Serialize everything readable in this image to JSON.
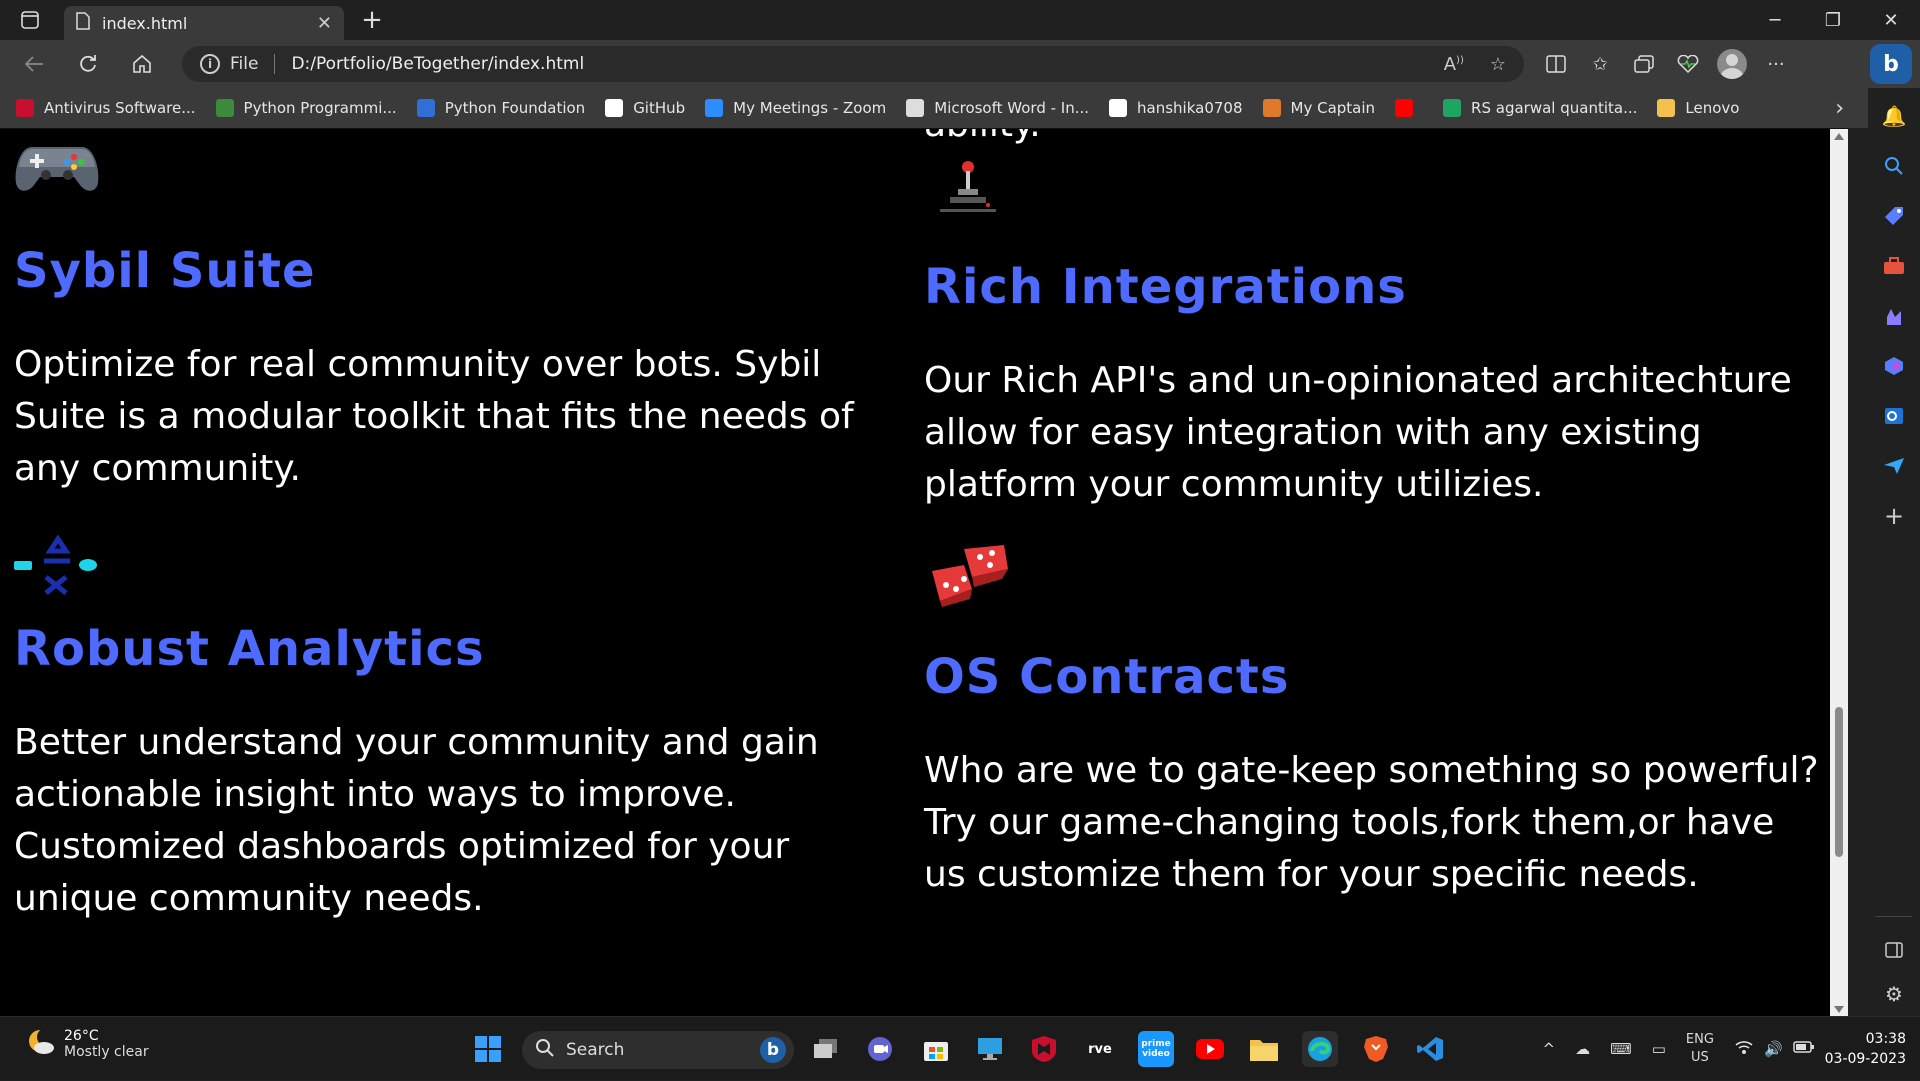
{
  "browser": {
    "tab": {
      "title": "index.html",
      "close": "✕"
    },
    "new_tab": "+",
    "window_controls": {
      "minimize": "─",
      "restore": "❐",
      "close": "✕"
    },
    "address": {
      "scheme": "File",
      "url": "D:/Portfolio/BeTogether/index.html"
    },
    "bookmarks": [
      {
        "label": "Antivirus Software...",
        "icon": "mcafee-icon",
        "color": "#c8102e"
      },
      {
        "label": "Python Programmi...",
        "icon": "python-icon",
        "color": "#3c8a3c"
      },
      {
        "label": "Python Foundation",
        "icon": "python-foundation-icon",
        "color": "#2f6fd6"
      },
      {
        "label": "GitHub",
        "icon": "github-icon",
        "color": "#ffffff"
      },
      {
        "label": "My Meetings - Zoom",
        "icon": "zoom-icon",
        "color": "#2d8cff"
      },
      {
        "label": "Microsoft Word - In...",
        "icon": "document-icon",
        "color": "#dddddd"
      },
      {
        "label": "hanshika0708",
        "icon": "github-icon",
        "color": "#ffffff"
      },
      {
        "label": "My Captain",
        "icon": "mycaptain-icon",
        "color": "#e0792b"
      },
      {
        "label": "",
        "icon": "youtube-icon",
        "color": "#ff0000"
      },
      {
        "label": "RS agarwal quantita...",
        "icon": "google-drive-icon",
        "color": "#1fa463"
      },
      {
        "label": "Lenovo",
        "icon": "folder-icon",
        "color": "#f2c14e"
      }
    ]
  },
  "page": {
    "top_fragment": "ability.",
    "features": [
      {
        "title": "Sybil Suite",
        "desc": "Optimize for real community over bots. Sybil Suite is a modular toolkit that fits the needs of any community.",
        "icon": "gamepad-icon"
      },
      {
        "title": "Robust Analytics",
        "desc": "Better understand your community and gain actionable insight into ways to improve. Customized dashboards optimized for your unique community needs.",
        "icon": "controller-buttons-icon"
      },
      {
        "title": "Rich Integrations",
        "desc": "Our Rich API's and un-opinionated architechture allow for easy integration with any existing platform your community utilizies.",
        "icon": "joystick-icon"
      },
      {
        "title": "OS Contracts",
        "desc": "Who are we to gate-keep something so powerful? Try our game-changing tools,fork them,or have us customize them for your specific needs.",
        "icon": "dice-icon"
      }
    ],
    "colors": {
      "title": "#4f6bff",
      "text": "#ffffff",
      "background": "#000000"
    }
  },
  "taskbar": {
    "weather": {
      "temp": "26°C",
      "condition": "Mostly clear"
    },
    "search_placeholder": "Search",
    "tray": {
      "lang": "ENG",
      "region": "US",
      "time": "03:38",
      "date": "03-09-2023"
    }
  }
}
